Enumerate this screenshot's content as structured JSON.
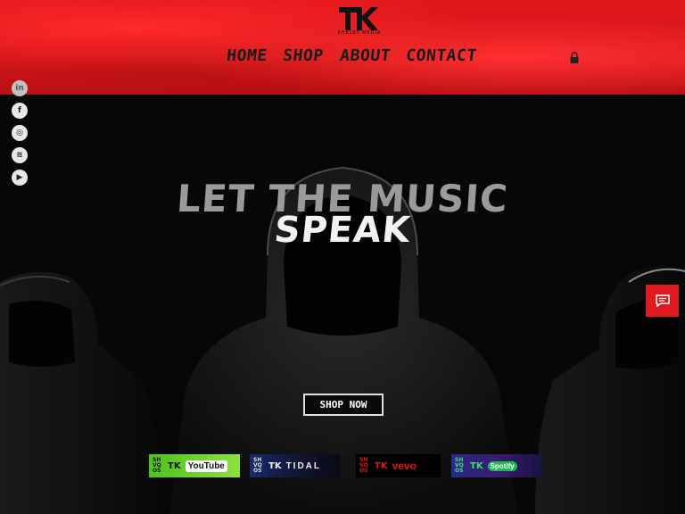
{
  "brand": {
    "logo_text": "TK",
    "logo_subtitle": "SHELBY MEDIA"
  },
  "nav": {
    "items": [
      "HOME",
      "SHOP",
      "ABOUT",
      "CONTACT"
    ],
    "cart_icon": "lock-bag-icon"
  },
  "social": {
    "icons": [
      "linkedin-icon",
      "facebook-icon",
      "instagram-icon",
      "spotify-icon",
      "youtube-icon"
    ],
    "glyphs": [
      "in",
      "f",
      "◎",
      "≋",
      "▶"
    ]
  },
  "hero": {
    "title_line1": "LET THE MUSIC",
    "title_line2": "SPEAK",
    "cta_label": "SHOP NOW"
  },
  "chat": {
    "icon": "chat-icon"
  },
  "partners": [
    {
      "brand": "YouTube",
      "tag": "SH VQ OS"
    },
    {
      "brand": "TIDAL",
      "tag": "SH VQ OS"
    },
    {
      "brand": "vevo",
      "tag": "SH VQ OS"
    },
    {
      "brand": "Spotify",
      "tag": "SH VQ OS"
    }
  ],
  "colors": {
    "header_red": "#d0151a",
    "accent_red": "#e0191e",
    "hero_bg": "#070707"
  }
}
